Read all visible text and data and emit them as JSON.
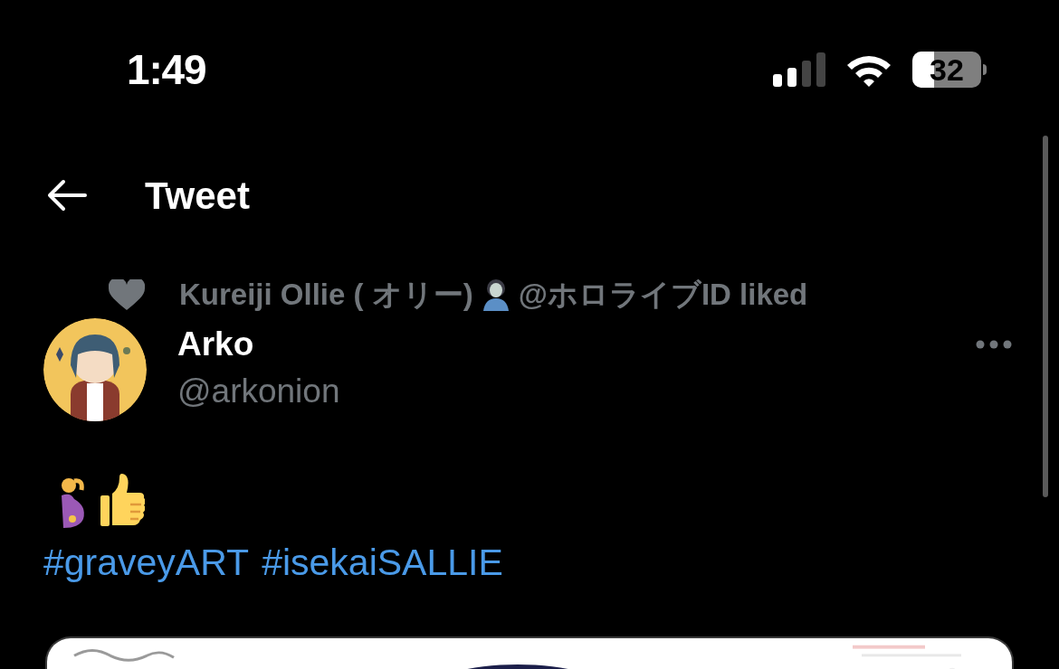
{
  "status_bar": {
    "time": "1:49",
    "battery": "32"
  },
  "header": {
    "title": "Tweet"
  },
  "social_context": {
    "name": "Kureiji Ollie ( オリー)",
    "rest": "@ホロライブID liked"
  },
  "author": {
    "name": "Arko",
    "handle": "@arkonion"
  },
  "body": {
    "hashtags": [
      "#graveyART",
      "#isekaiSALLIE"
    ]
  }
}
